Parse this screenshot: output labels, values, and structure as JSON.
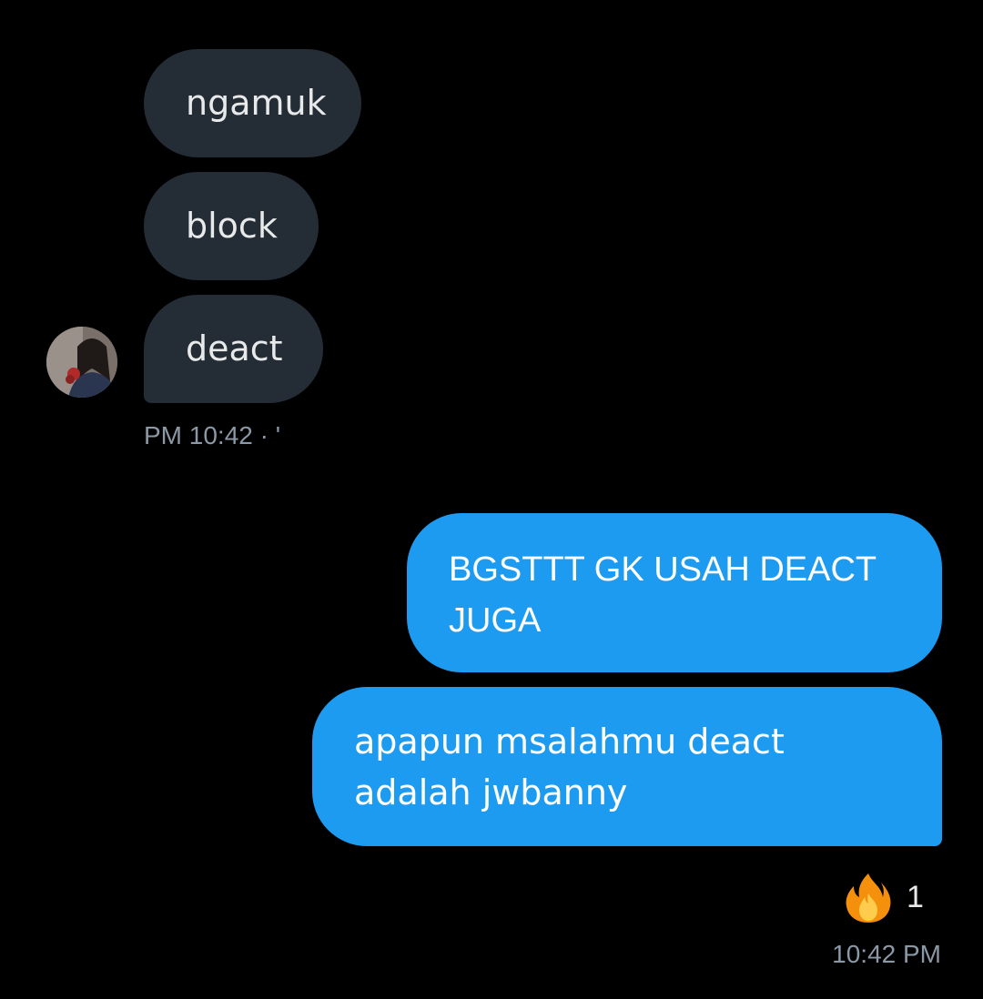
{
  "incoming": {
    "messages": [
      {
        "text": "ngamuk"
      },
      {
        "text": "block"
      },
      {
        "text": "deact"
      }
    ],
    "timestamp": "PM 10:42 · '",
    "avatar_icon": "user-avatar"
  },
  "outgoing": {
    "messages": [
      {
        "text": "BGSTTT GK USAH DEACT JUGA"
      },
      {
        "text": "apapun msalahmu deact adalah jwbanny"
      }
    ],
    "reaction": {
      "icon": "fire-emoji",
      "count": "1"
    },
    "timestamp": "10:42 PM"
  },
  "colors": {
    "background": "#000000",
    "incoming_bubble": "#242d35",
    "outgoing_bubble": "#1d9bf0",
    "meta_text": "#8b98a5"
  }
}
